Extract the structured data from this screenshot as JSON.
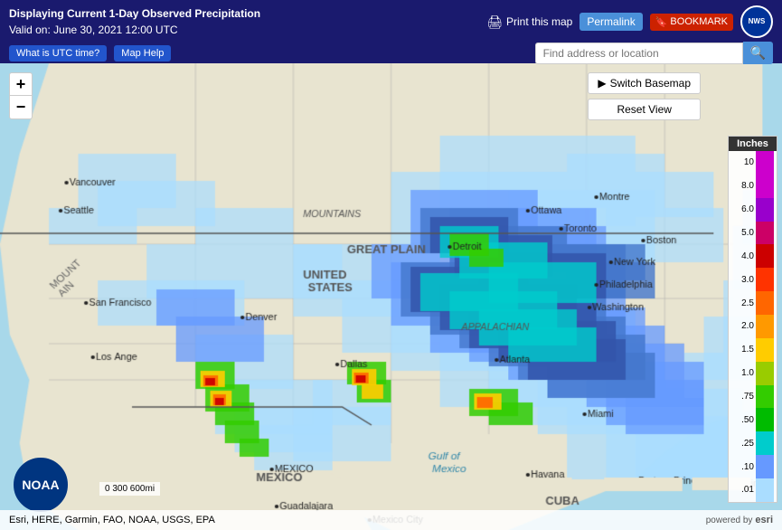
{
  "header": {
    "title_line1": "Displaying Current 1-Day Observed Precipitation",
    "title_line2": "Valid on: June 30, 2021 12:00 UTC",
    "print_label": "Print this map",
    "permalink_label": "Permalink",
    "bookmark_label": "BOOKMARK",
    "utc_btn_label": "What is UTC time?",
    "maphelp_btn_label": "Map Help",
    "search_placeholder": "Find address or location"
  },
  "map_controls": {
    "switch_basemap": "Switch Basemap",
    "reset_view": "Reset View",
    "zoom_in": "+",
    "zoom_out": "−"
  },
  "legend": {
    "title": "Inches",
    "items": [
      {
        "value": "10",
        "color": "#cc00cc"
      },
      {
        "value": "8.0",
        "color": "#cc00cc"
      },
      {
        "value": "6.0",
        "color": "#9900cc"
      },
      {
        "value": "5.0",
        "color": "#cc0066"
      },
      {
        "value": "4.0",
        "color": "#cc0000"
      },
      {
        "value": "3.0",
        "color": "#ff3300"
      },
      {
        "value": "2.5",
        "color": "#ff6600"
      },
      {
        "value": "2.0",
        "color": "#ff9900"
      },
      {
        "value": "1.5",
        "color": "#ffcc00"
      },
      {
        "value": "1.0",
        "color": "#99cc00"
      },
      {
        "value": ".75",
        "color": "#33cc00"
      },
      {
        "value": ".50",
        "color": "#00bb00"
      },
      {
        "value": ".25",
        "color": "#00cccc"
      },
      {
        "value": ".10",
        "color": "#6699ff"
      },
      {
        "value": ".01",
        "color": "#aaddff"
      }
    ]
  },
  "scale_bar": {
    "label": "0    300    600mi"
  },
  "attribution": {
    "text": "Esri, HERE, Garmin, FAO, NOAA, USGS, EPA",
    "powered_by": "powered by",
    "esri": "esri"
  },
  "noaa": {
    "text": "NOAA"
  }
}
